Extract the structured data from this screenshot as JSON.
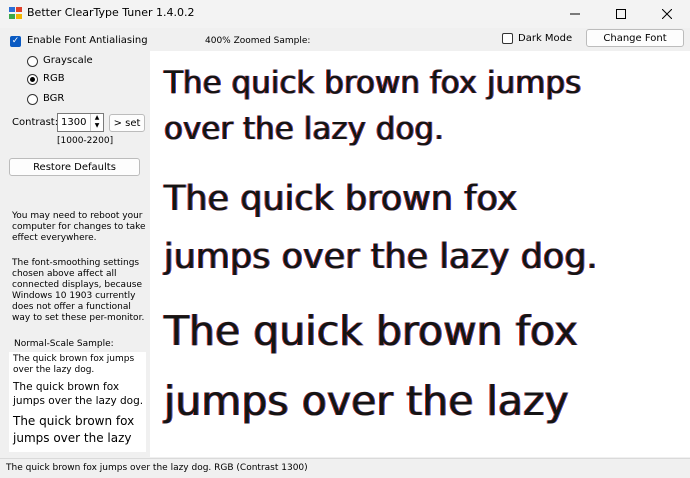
{
  "window": {
    "title": "Better ClearType Tuner 1.4.0.2"
  },
  "controls": {
    "antialias_label": "Enable Font Antialiasing",
    "grayscale_label": "Grayscale",
    "rgb_label": "RGB",
    "bgr_label": "BGR",
    "contrast_label": "Contrast:",
    "contrast_value": "1300",
    "set_label": "> set",
    "range_label": "[1000-2200]",
    "restore_label": "Restore Defaults",
    "dark_mode_label": "Dark Mode",
    "change_font_label": "Change Font",
    "zoom_label": "400% Zoomed Sample:"
  },
  "info": {
    "reboot": "You may need to reboot your computer for changes to take effect everywhere.",
    "display": "The font-smoothing settings chosen above affect all connected displays, because Windows 10 1903 currently does not offer a functional way to set these per-monitor."
  },
  "normal_sample": {
    "title": "Normal-Scale Sample:",
    "lines": [
      "The quick brown fox jumps",
      "over the lazy dog.",
      "The quick brown fox",
      "jumps over the lazy dog.",
      "The quick brown fox",
      "jumps over the lazy"
    ]
  },
  "zoom_sample": {
    "lines": [
      "The quick brown fox jumps",
      "over the lazy dog.",
      "The quick brown fox",
      "jumps over the lazy dog.",
      "The quick brown fox",
      "jumps over the lazy"
    ]
  },
  "status": {
    "text": "The quick brown fox jumps over the lazy dog. RGB (Contrast 1300)"
  },
  "colors": {
    "accent": "#0a5ac2",
    "fringe_red": "#d8441c",
    "fringe_blue": "#3a5ddc"
  }
}
